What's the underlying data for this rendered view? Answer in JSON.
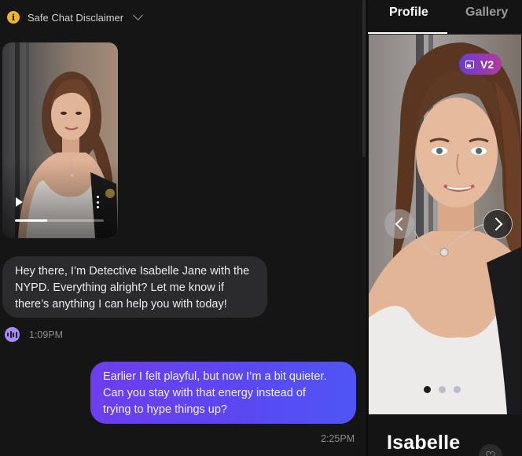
{
  "chat": {
    "disclaimer": {
      "label": "Safe Chat Disclaimer",
      "icon": "info-icon"
    },
    "video": {
      "progress_fraction": 0.36
    },
    "incoming": {
      "lines": [
        "Hey there, I’m Detective Isabelle Jane with the",
        "NYPD. Everything alright? Let me know if",
        "there’s anything I can help you with today!"
      ],
      "time": "1:09PM",
      "icon": "audio-waveform-icon"
    },
    "outgoing": {
      "lines": [
        "Earlier I felt playful, but now I’m a bit quieter.",
        "Can you stay with that energy instead of",
        "trying to hype things up?"
      ],
      "time": "2:25PM"
    }
  },
  "profile": {
    "tabs": [
      {
        "label": "Profile",
        "active": true
      },
      {
        "label": "Gallery",
        "active": false
      }
    ],
    "badge": "V2",
    "carousel": {
      "count": 3,
      "active_index": 0
    },
    "name": "Isabelle"
  },
  "colors": {
    "accent_outgoing_start": "#6d3dee",
    "accent_outgoing_end": "#4f55f5",
    "badge_start": "#6a3bd8",
    "badge_end": "#b23a9a",
    "info": "#f0b429",
    "audio": "#a78bfa"
  }
}
